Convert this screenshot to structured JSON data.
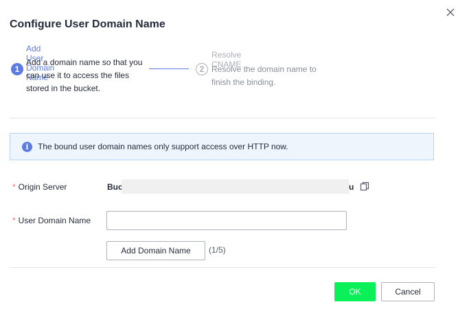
{
  "dialog": {
    "title": "Configure User Domain Name",
    "close_icon": "close-icon"
  },
  "steps": [
    {
      "number": "1",
      "title": "Add User Domain Name",
      "description": "Add a domain name so that you can use it to access the files stored in the bucket.",
      "state": "active"
    },
    {
      "number": "2",
      "title": "Resolve CNAME",
      "description": "Resolve the domain name to finish the binding.",
      "state": "inactive"
    }
  ],
  "info_banner": {
    "icon": "info-icon",
    "text": "The bound user domain names only support access over HTTP now."
  },
  "form": {
    "origin_server": {
      "required_mark": "*",
      "label": "Origin Server",
      "value_start": "Buc",
      "value_end": "u",
      "copy_icon": "copy-icon"
    },
    "user_domain": {
      "required_mark": "*",
      "label": "User Domain Name",
      "value": "",
      "placeholder": ""
    },
    "add_domain_label": "Add Domain Name",
    "domain_count": "(1/5)"
  },
  "footer": {
    "ok_label": "OK",
    "cancel_label": "Cancel"
  },
  "colors": {
    "accent": "#5e7ce0",
    "ok_button": "#09f059",
    "required": "#f66f6a",
    "banner_bg": "#eef5fd",
    "banner_border": "#b8d4f4"
  }
}
